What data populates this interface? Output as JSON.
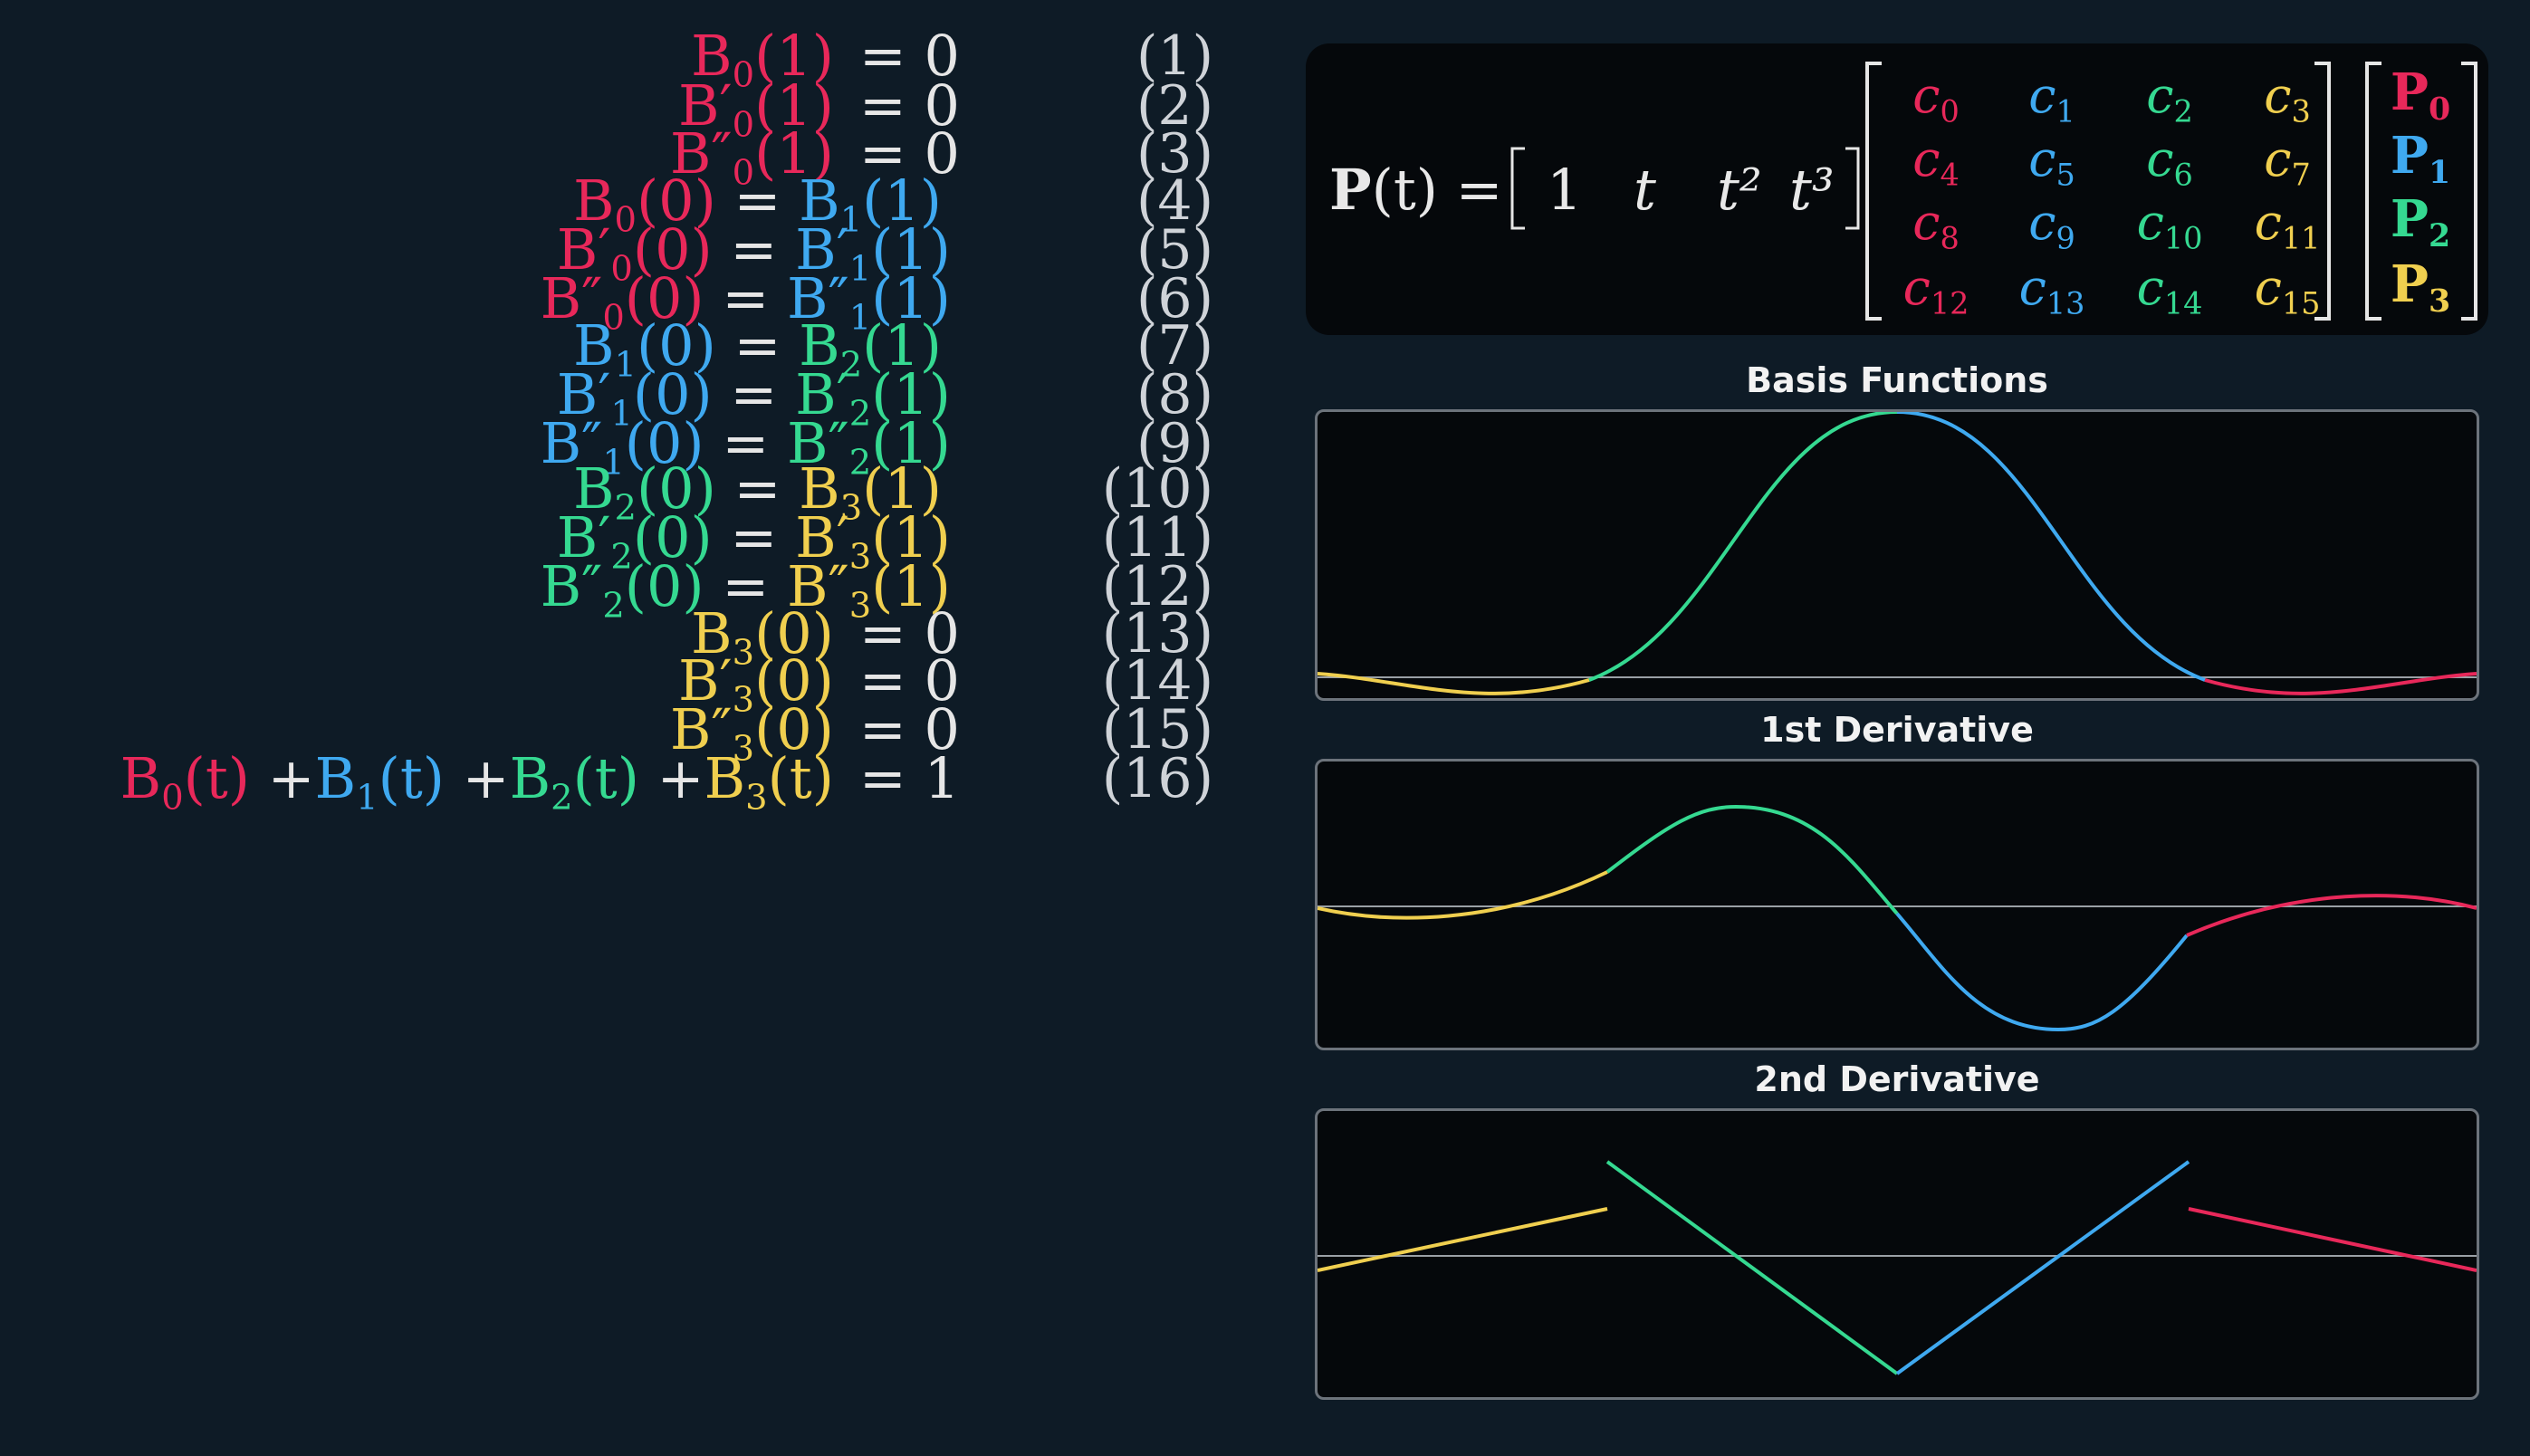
{
  "equations": [
    {
      "lhs": [
        {
          "text": "B",
          "sub": "0",
          "arg": "(1)",
          "color": "red"
        }
      ],
      "rhs": [
        {
          "text": "= 0",
          "color": "white"
        }
      ],
      "num": "(1)"
    },
    {
      "lhs": [
        {
          "text": "B′",
          "sub": "0",
          "arg": "(1)",
          "color": "red"
        }
      ],
      "rhs": [
        {
          "text": "= 0",
          "color": "white"
        }
      ],
      "num": "(2)"
    },
    {
      "lhs": [
        {
          "text": "B″",
          "sub": "0",
          "arg": "(1)",
          "color": "red"
        }
      ],
      "rhs": [
        {
          "text": "= 0",
          "color": "white"
        }
      ],
      "num": "(3)"
    },
    {
      "lhs": [
        {
          "text": "B",
          "sub": "0",
          "arg": "(0)",
          "color": "red"
        },
        {
          "text": " = ",
          "color": "white"
        },
        {
          "text": "B",
          "sub": "1",
          "arg": "(1)",
          "color": "blue"
        }
      ],
      "rhs": [],
      "num": "(4)"
    },
    {
      "lhs": [
        {
          "text": "B′",
          "sub": "0",
          "arg": "(0)",
          "color": "red"
        },
        {
          "text": " = ",
          "color": "white"
        },
        {
          "text": "B′",
          "sub": "1",
          "arg": "(1)",
          "color": "blue"
        }
      ],
      "rhs": [],
      "num": "(5)"
    },
    {
      "lhs": [
        {
          "text": "B″",
          "sub": "0",
          "arg": "(0)",
          "color": "red"
        },
        {
          "text": " = ",
          "color": "white"
        },
        {
          "text": "B″",
          "sub": "1",
          "arg": "(1)",
          "color": "blue"
        }
      ],
      "rhs": [],
      "num": "(6)"
    },
    {
      "lhs": [
        {
          "text": "B",
          "sub": "1",
          "arg": "(0)",
          "color": "blue"
        },
        {
          "text": " = ",
          "color": "white"
        },
        {
          "text": "B",
          "sub": "2",
          "arg": "(1)",
          "color": "green"
        }
      ],
      "rhs": [],
      "num": "(7)"
    },
    {
      "lhs": [
        {
          "text": "B′",
          "sub": "1",
          "arg": "(0)",
          "color": "blue"
        },
        {
          "text": " = ",
          "color": "white"
        },
        {
          "text": "B′",
          "sub": "2",
          "arg": "(1)",
          "color": "green"
        }
      ],
      "rhs": [],
      "num": "(8)"
    },
    {
      "lhs": [
        {
          "text": "B″",
          "sub": "1",
          "arg": "(0)",
          "color": "blue"
        },
        {
          "text": " = ",
          "color": "white"
        },
        {
          "text": "B″",
          "sub": "2",
          "arg": "(1)",
          "color": "green"
        }
      ],
      "rhs": [],
      "num": "(9)"
    },
    {
      "lhs": [
        {
          "text": "B",
          "sub": "2",
          "arg": "(0)",
          "color": "green"
        },
        {
          "text": " = ",
          "color": "white"
        },
        {
          "text": "B",
          "sub": "3",
          "arg": "(1)",
          "color": "yellow"
        }
      ],
      "rhs": [],
      "num": "(10)"
    },
    {
      "lhs": [
        {
          "text": "B′",
          "sub": "2",
          "arg": "(0)",
          "color": "green"
        },
        {
          "text": " = ",
          "color": "white"
        },
        {
          "text": "B′",
          "sub": "3",
          "arg": "(1)",
          "color": "yellow"
        }
      ],
      "rhs": [],
      "num": "(11)"
    },
    {
      "lhs": [
        {
          "text": "B″",
          "sub": "2",
          "arg": "(0)",
          "color": "green"
        },
        {
          "text": " = ",
          "color": "white"
        },
        {
          "text": "B″",
          "sub": "3",
          "arg": "(1)",
          "color": "yellow"
        }
      ],
      "rhs": [],
      "num": "(12)"
    },
    {
      "lhs": [
        {
          "text": "B",
          "sub": "3",
          "arg": "(0)",
          "color": "yellow"
        }
      ],
      "rhs": [
        {
          "text": "= 0",
          "color": "white"
        }
      ],
      "num": "(13)"
    },
    {
      "lhs": [
        {
          "text": "B′",
          "sub": "3",
          "arg": "(0)",
          "color": "yellow"
        }
      ],
      "rhs": [
        {
          "text": "= 0",
          "color": "white"
        }
      ],
      "num": "(14)"
    },
    {
      "lhs": [
        {
          "text": "B″",
          "sub": "3",
          "arg": "(0)",
          "color": "yellow"
        }
      ],
      "rhs": [
        {
          "text": "= 0",
          "color": "white"
        }
      ],
      "num": "(15)"
    },
    {
      "lhs": [
        {
          "text": "B",
          "sub": "0",
          "arg": "(t)",
          "color": "red"
        },
        {
          "text": " +",
          "color": "white"
        },
        {
          "text": "B",
          "sub": "1",
          "arg": "(t)",
          "color": "blue"
        },
        {
          "text": " +",
          "color": "white"
        },
        {
          "text": "B",
          "sub": "2",
          "arg": "(t)",
          "color": "green"
        },
        {
          "text": " +",
          "color": "white"
        },
        {
          "text": "B",
          "sub": "3",
          "arg": "(t)",
          "color": "yellow"
        }
      ],
      "rhs": [
        {
          "text": "= 1",
          "color": "white"
        }
      ],
      "num": "(16)"
    }
  ],
  "matrix": {
    "lhs_bold": "P",
    "lhs_rest": "(t) =",
    "row_vector": [
      "1",
      "t",
      "t²",
      "t³"
    ],
    "coefficients": [
      [
        {
          "base": "c",
          "sub": "0",
          "color": "red"
        },
        {
          "base": "c",
          "sub": "1",
          "color": "blue"
        },
        {
          "base": "c",
          "sub": "2",
          "color": "green"
        },
        {
          "base": "c",
          "sub": "3",
          "color": "yellow"
        }
      ],
      [
        {
          "base": "c",
          "sub": "4",
          "color": "red"
        },
        {
          "base": "c",
          "sub": "5",
          "color": "blue"
        },
        {
          "base": "c",
          "sub": "6",
          "color": "green"
        },
        {
          "base": "c",
          "sub": "7",
          "color": "yellow"
        }
      ],
      [
        {
          "base": "c",
          "sub": "8",
          "color": "red"
        },
        {
          "base": "c",
          "sub": "9",
          "color": "blue"
        },
        {
          "base": "c",
          "sub": "10",
          "color": "green"
        },
        {
          "base": "c",
          "sub": "11",
          "color": "yellow"
        }
      ],
      [
        {
          "base": "c",
          "sub": "12",
          "color": "red"
        },
        {
          "base": "c",
          "sub": "13",
          "color": "blue"
        },
        {
          "base": "c",
          "sub": "14",
          "color": "green"
        },
        {
          "base": "c",
          "sub": "15",
          "color": "yellow"
        }
      ]
    ],
    "points": [
      {
        "base": "P",
        "sub": "0",
        "color": "red"
      },
      {
        "base": "P",
        "sub": "1",
        "color": "blue"
      },
      {
        "base": "P",
        "sub": "2",
        "color": "green"
      },
      {
        "base": "P",
        "sub": "3",
        "color": "yellow"
      }
    ]
  },
  "plots": [
    {
      "title": "Basis Functions"
    },
    {
      "title": "1st Derivative"
    },
    {
      "title": "2nd Derivative"
    }
  ],
  "colors": {
    "red": "#e8285a",
    "blue": "#3fa9f0",
    "green": "#35d991",
    "yellow": "#f0cf4f",
    "white": "#e6e6e6",
    "background": "#0e1b26",
    "panel": "#05080b",
    "axis": "#9aa0a6"
  }
}
